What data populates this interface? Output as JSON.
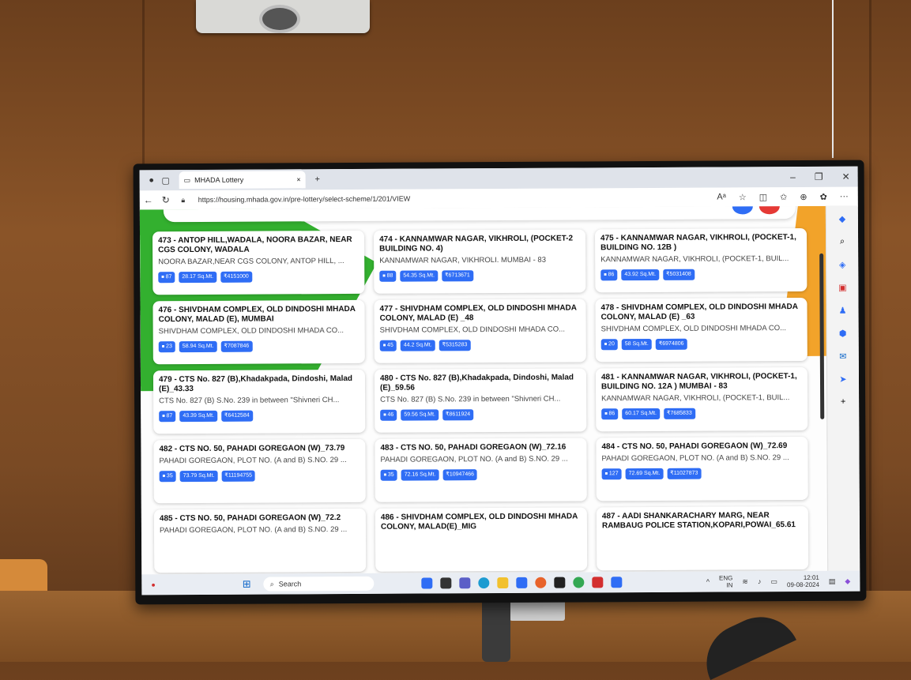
{
  "browser": {
    "tab_title": "MHADA Lottery",
    "url": "https://housing.mhada.gov.in/pre-lottery/select-scheme/1/201/VIEW",
    "new_tab": "+",
    "close_tab": "×"
  },
  "cards": [
    {
      "title": "473 - ANTOP HILL,WADALA, NOORA BAZAR, NEAR CGS COLONY, WADALA",
      "address": "NOORA BAZAR,NEAR CGS COLONY, ANTOP HILL, ...",
      "units": "87",
      "area": "28.17 Sq.Mt.",
      "price": "₹4151000"
    },
    {
      "title": "474 - KANNAMWAR NAGAR, VIKHROLI, (POCKET-2 BUILDING NO. 4)",
      "address": "KANNAMWAR NAGAR, VIKHROLI. MUMBAI - 83",
      "units": "88",
      "area": "54.35 Sq.Mt.",
      "price": "₹6713671"
    },
    {
      "title": "475 - KANNAMWAR NAGAR, VIKHROLI, (POCKET-1, BUILDING NO. 12B )",
      "address": "KANNAMWAR NAGAR, VIKHROLI, (POCKET-1, BUIL...",
      "units": "86",
      "area": "43.92 Sq.Mt.",
      "price": "₹5031408"
    },
    {
      "title": "476 - SHIVDHAM COMPLEX, OLD DINDOSHI MHADA COLONY, MALAD (E), MUMBAI",
      "address": "SHIVDHAM COMPLEX, OLD DINDOSHI MHADA CO...",
      "units": "23",
      "area": "58.94 Sq.Mt.",
      "price": "₹7087846"
    },
    {
      "title": "477 - SHIVDHAM COMPLEX, OLD DINDOSHI MHADA COLONY, MALAD (E) _48",
      "address": "SHIVDHAM COMPLEX, OLD DINDOSHI MHADA CO...",
      "units": "45",
      "area": "44.2 Sq.Mt.",
      "price": "₹5315283"
    },
    {
      "title": "478 - SHIVDHAM COMPLEX, OLD DINDOSHI MHADA COLONY, MALAD (E) _63",
      "address": "SHIVDHAM COMPLEX, OLD DINDOSHI MHADA CO...",
      "units": "20",
      "area": "58 Sq.Mt.",
      "price": "₹6974806"
    },
    {
      "title": "479 - CTS No. 827 (B),Khadakpada, Dindoshi, Malad (E)_43.33",
      "address": "CTS No. 827 (B) S.No. 239 in between \"Shivneri CH...",
      "units": "87",
      "area": "43.39 Sq.Mt.",
      "price": "₹6412584"
    },
    {
      "title": "480 - CTS No. 827 (B),Khadakpada, Dindoshi, Malad (E)_59.56",
      "address": "CTS No. 827 (B) S.No. 239 in between \"Shivneri CH...",
      "units": "46",
      "area": "59.56 Sq.Mt.",
      "price": "₹8611924"
    },
    {
      "title": "481 - KANNAMWAR NAGAR, VIKHROLI, (POCKET-1, BUILDING NO. 12A ) MUMBAI - 83",
      "address": "KANNAMWAR NAGAR, VIKHROLI, (POCKET-1, BUIL...",
      "units": "86",
      "area": "60.17 Sq.Mt.",
      "price": "₹7685833"
    },
    {
      "title": "482 - CTS NO. 50, PAHADI GOREGAON (W)_73.79",
      "address": "PAHADI GOREGAON, PLOT NO. (A and B) S.NO. 29 ...",
      "units": "35",
      "area": "73.79 Sq.Mt.",
      "price": "₹11194755"
    },
    {
      "title": "483 - CTS NO. 50, PAHADI GOREGAON (W)_72.16",
      "address": "PAHADI GOREGAON, PLOT NO. (A and B) S.NO. 29 ...",
      "units": "35",
      "area": "72.16 Sq.Mt.",
      "price": "₹10947466"
    },
    {
      "title": "484 - CTS NO. 50, PAHADI GOREGAON (W)_72.69",
      "address": "PAHADI GOREGAON, PLOT NO. (A and B) S.NO. 29 ...",
      "units": "127",
      "area": "72.69 Sq.Mt.",
      "price": "₹11027873"
    },
    {
      "title": "485 - CTS NO. 50, PAHADI GOREGAON (W)_72.2",
      "address": "PAHADI GOREGAON, PLOT NO. (A and B) S.NO. 29 ...",
      "units": "",
      "area": "",
      "price": ""
    },
    {
      "title": "486 - SHIVDHAM COMPLEX, OLD DINDOSHI MHADA COLONY, MALAD(E)_MIG",
      "address": "",
      "units": "",
      "area": "",
      "price": ""
    },
    {
      "title": "487 - AADI SHANKARACHARY MARG, NEAR RAMBAUG POLICE STATION,KOPARI,POWAI_65.61",
      "address": "",
      "units": "",
      "area": "",
      "price": ""
    }
  ],
  "taskbar": {
    "search": "Search",
    "lang": "ENG",
    "region": "IN",
    "time": "12:01",
    "date": "09-08-2024"
  },
  "colors": {
    "chip": "#2f6df5",
    "green": "#33b02f",
    "orange": "#f2a32a"
  }
}
